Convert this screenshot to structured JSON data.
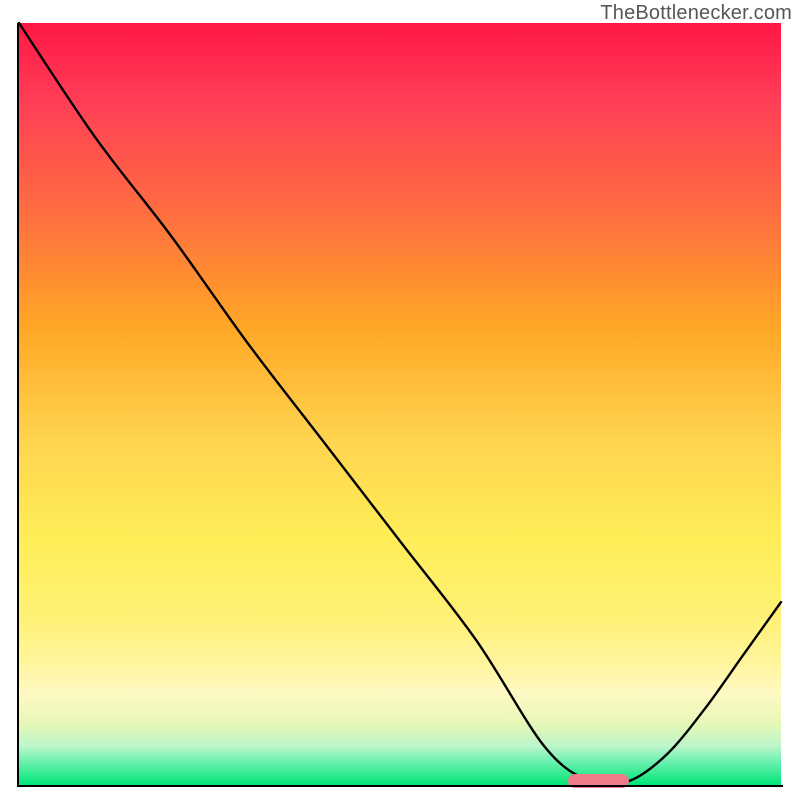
{
  "watermark": "TheBottlenecker.com",
  "chart_data": {
    "type": "line",
    "title": "",
    "xlabel": "",
    "ylabel": "",
    "xlim": [
      0,
      100
    ],
    "ylim": [
      0,
      100
    ],
    "grid": false,
    "x": [
      0,
      10,
      20,
      30,
      40,
      50,
      60,
      69,
      75,
      80,
      85,
      90,
      95,
      100
    ],
    "values": [
      100,
      85,
      72,
      58,
      45,
      32,
      19,
      5,
      0.5,
      0.5,
      4,
      10,
      17,
      24
    ],
    "optimum_marker": {
      "x_start": 72,
      "x_end": 80,
      "y": 0.5
    },
    "background_gradient": {
      "top": "#ff1744",
      "mid_high": "#ffa726",
      "mid": "#ffee58",
      "low": "#00e676"
    },
    "curve_color": "#000000",
    "marker_color": "#ef7a8a"
  }
}
